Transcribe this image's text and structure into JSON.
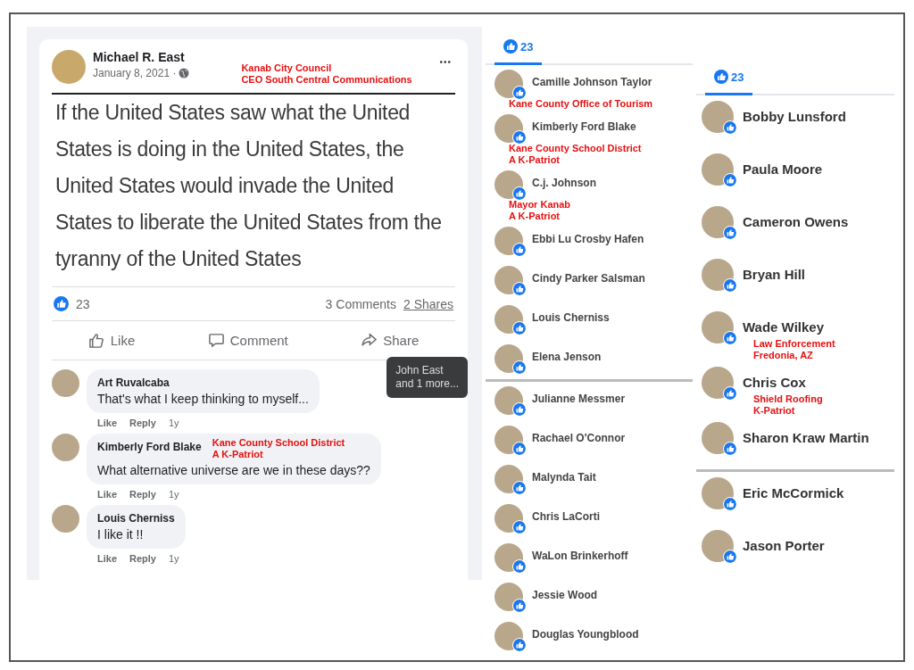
{
  "post": {
    "author": "Michael R. East",
    "date": "January 8, 2021 ·",
    "note": [
      "Kanab City Council",
      "CEO South Central Communications"
    ],
    "more": "•••",
    "text": "If the United States saw what the United States is doing in the United States, the United States would invade the United States to liberate the United States from the tyranny of the United States",
    "reaction_count": "23",
    "comments_count": "3 Comments",
    "shares_link": "2 Shares",
    "actions": [
      {
        "kind": "like",
        "label": "Like"
      },
      {
        "kind": "comment",
        "label": "Comment"
      },
      {
        "kind": "share",
        "label": "Share"
      }
    ],
    "tooltip": [
      "John East",
      "and 1 more..."
    ]
  },
  "comments": [
    {
      "author": "Art Ruvalcaba",
      "text": "That's what I keep thinking to myself...",
      "actions": [
        "Like",
        "Reply",
        "1y"
      ]
    },
    {
      "author": "Kimberly Ford Blake",
      "text": "What alternative universe are we in these days??",
      "note": [
        "Kane County School District",
        "A K-Patriot"
      ],
      "actions": [
        "Like",
        "Reply",
        "1y"
      ]
    },
    {
      "author": "Louis Cherniss",
      "text": "I like it !!",
      "actions": [
        "Like",
        "Reply",
        "1y"
      ]
    }
  ],
  "reaction_panels": [
    {
      "tab": {
        "count": "23",
        "selected": true
      },
      "sections": [
        [
          {
            "name": "Camille Johnson Taylor",
            "note": [
              "Kane County Office of Tourism"
            ]
          },
          {
            "name": "Kimberly Ford Blake",
            "note": [
              "Kane County School District",
              "A K-Patriot"
            ]
          },
          {
            "name": "C.j. Johnson",
            "note": [
              "Mayor Kanab",
              "A K-Patriot"
            ]
          },
          {
            "name": "Ebbi Lu Crosby Hafen"
          },
          {
            "name": "Cindy Parker Salsman"
          },
          {
            "name": "Louis Cherniss"
          },
          {
            "name": "Elena Jenson"
          }
        ],
        [
          {
            "name": "Julianne Messmer"
          },
          {
            "name": "Rachael O'Connor"
          },
          {
            "name": "Malynda Tait"
          },
          {
            "name": "Chris LaCorti"
          },
          {
            "name": "WaLon Brinkerhoff"
          },
          {
            "name": "Jessie Wood"
          },
          {
            "name": "Douglas Youngblood"
          }
        ]
      ]
    },
    {
      "tab": {
        "count": "23",
        "selected": true
      },
      "sections": [
        [
          {
            "name": "Bobby Lunsford"
          },
          {
            "name": "Paula Moore"
          },
          {
            "name": "Cameron Owens"
          },
          {
            "name": "Bryan Hill"
          },
          {
            "name": "Wade Wilkey",
            "note": [
              "Law Enforcement",
              "Fredonia, AZ"
            ]
          },
          {
            "name": "Chris Cox",
            "note": [
              "Shield Roofing",
              "K-Patriot"
            ]
          },
          {
            "name": "Sharon Kraw Martin"
          }
        ],
        [
          {
            "name": "Eric McCormick"
          },
          {
            "name": "Jason Porter"
          }
        ]
      ]
    }
  ]
}
